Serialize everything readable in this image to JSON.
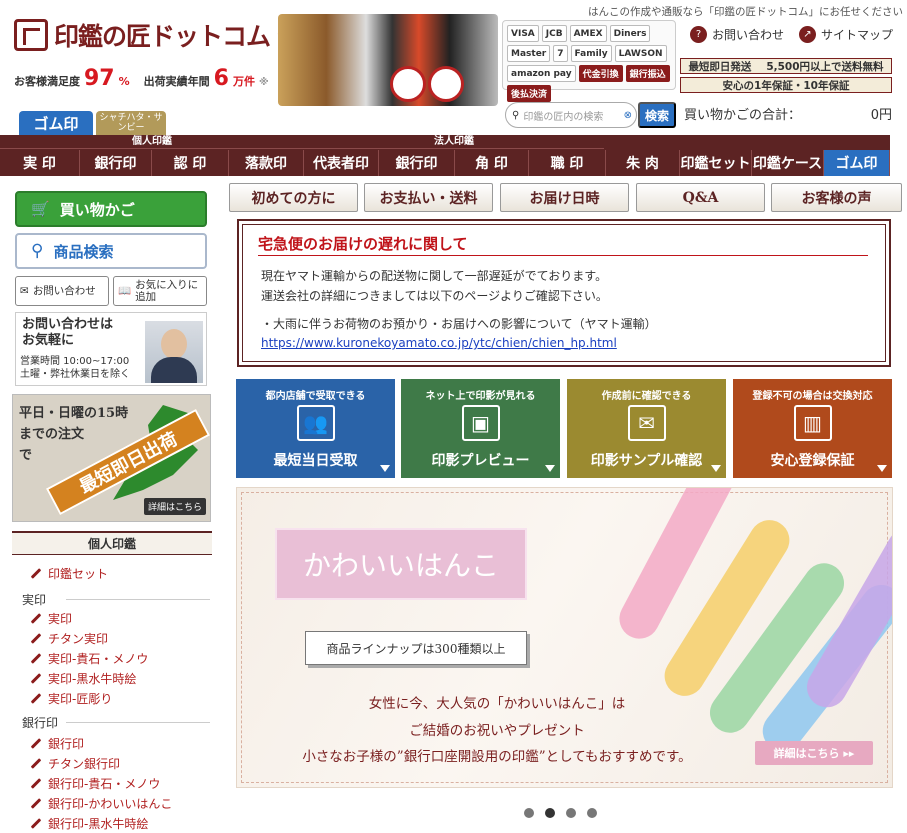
{
  "header": {
    "tagline": "はんこの作成や通販なら「印鑑の匠ドットコム」にお任せください",
    "logo_text": "印鑑の匠ドットコム",
    "logo_reg": "®",
    "satisfaction_label": "お客様満足度",
    "satisfaction_value": "97",
    "satisfaction_unit": "%",
    "shipments_label": "出荷実績年間",
    "shipments_value": "6",
    "shipments_unit": "万件",
    "shipments_note": "※",
    "contact_label": "お問い合わせ",
    "sitemap_label": "サイトマップ",
    "ship_badges": [
      "最短即日発送",
      "5,500円以上で送料無料"
    ],
    "guarantee": "安心の1年保証・10年保証",
    "search_placeholder": "印鑑の匠内の検索",
    "search_button": "検索",
    "cart_label": "買い物かごの合計：",
    "cart_total": "0円"
  },
  "payments": [
    "VISA",
    "JCB",
    "AMEX",
    "Diners",
    "Master",
    "7",
    "Family",
    "LAWSON",
    "amazon pay",
    "代金引換",
    "銀行振込",
    "後払決済"
  ],
  "tabs": {
    "gom": "ゴム印",
    "shachihata": "シャチハタ・サンビー"
  },
  "nav": {
    "group_personal": "個人印鑑",
    "group_corp": "法人印鑑",
    "items": [
      "実 印",
      "銀行印",
      "認 印",
      "落款印",
      "代表者印",
      "銀行印",
      "角 印",
      "職 印",
      "朱 肉",
      "印鑑セット",
      "印鑑ケース",
      "ゴム印"
    ]
  },
  "subnav": [
    "初めての方に",
    "お支払い・送料",
    "お届け日時",
    "Q&A",
    "お客様の声"
  ],
  "sidebar": {
    "cart_button": "買い物かご",
    "search_button": "商品検索",
    "inquiry_button": "お問い合わせ",
    "favorite_button": "お気に入りに追加",
    "contact_title_1": "お問い合わせは",
    "contact_title_2": "お気軽に",
    "hours": "営業時間 10:00~17:00",
    "holidays": "土曜・弊社休業日を除く",
    "sameday_1": "平日・日曜の15時",
    "sameday_2": "までの注文",
    "sameday_3": "で",
    "sameday_band": "最短即日出荷",
    "sameday_more": "詳細はこちら",
    "category_head": "個人印鑑",
    "set_item": "印鑑セット",
    "sub_jitsuin": "実印",
    "jitsuin_items": [
      "実印",
      "チタン実印",
      "実印-貴石・メノウ",
      "実印-黒水牛時絵",
      "実印-匠彫り"
    ],
    "sub_ginko": "銀行印",
    "ginko_items": [
      "銀行印",
      "チタン銀行印",
      "銀行印-貴石・メノウ",
      "銀行印-かわいいはんこ",
      "銀行印-黒水牛時絵"
    ]
  },
  "notice": {
    "title": "宅急便のお届けの遅れに関して",
    "line1": "現在ヤマト運輸からの配送物に関して一部遅延がでております。",
    "line2": "運送会社の詳細につきましては以下のページよりご確認下さい。",
    "line3": "・大雨に伴うお荷物のお預かり・お届けへの影響について（ヤマト運輸）",
    "link": "https://www.kuronekoyamato.co.jp/ytc/chien/chien_hp.html"
  },
  "features": [
    {
      "top": "都内店舗で受取できる",
      "label": "最短当日受取",
      "color": "#2a63a8",
      "icon": "people-icon"
    },
    {
      "top": "ネット上で印影が見れる",
      "label": "印影プレビュー",
      "color": "#3f7a48",
      "icon": "monitor-icon"
    },
    {
      "top": "作成前に確認できる",
      "label": "印影サンプル確認",
      "color": "#9b8a30",
      "icon": "mail-icon"
    },
    {
      "top": "登録不可の場合は交換対応",
      "label": "安心登録保証",
      "color": "#b04a1c",
      "icon": "cityhall-icon"
    }
  ],
  "banner": {
    "title": "かわいいはんこ",
    "sub": "商品ラインナップは300種類以上",
    "copy1": "女性に今、大人気の「かわいいはんこ」は",
    "copy2": "ご結婚のお祝いやプレゼント",
    "copy3": "小さなお子様の”銀行口座開設用の印鑑”としてもおすすめです。",
    "more": "詳細はこちら ▸▸"
  },
  "carousel": {
    "count": 4,
    "active": 2
  }
}
